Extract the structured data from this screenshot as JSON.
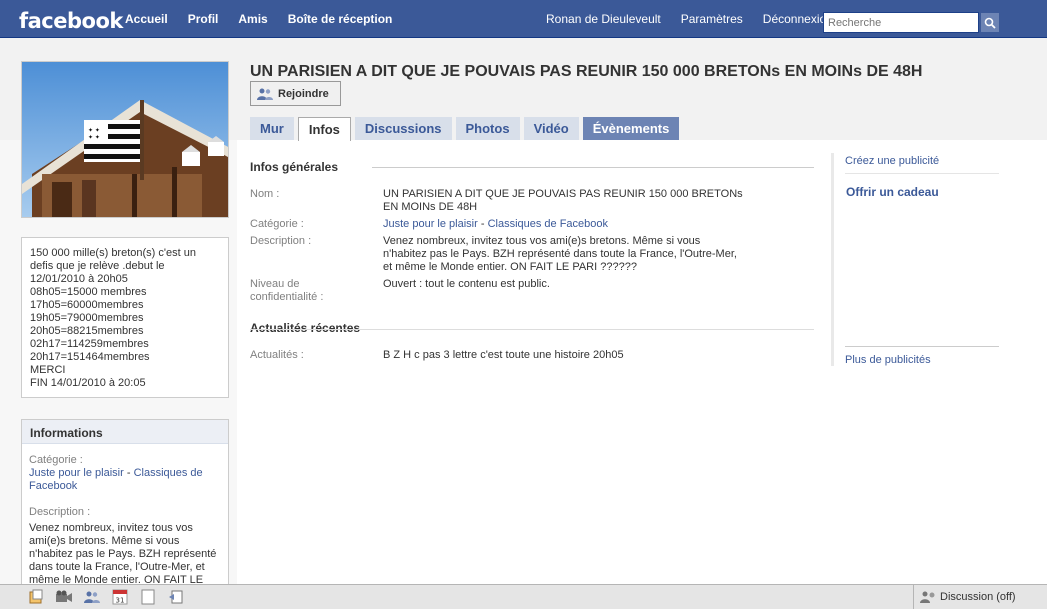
{
  "topbar": {
    "logo": "facebook",
    "nav_left": [
      "Accueil",
      "Profil",
      "Amis",
      "Boîte de réception"
    ],
    "nav_right": [
      "Ronan de Dieuleveult",
      "Paramètres",
      "Déconnexion"
    ],
    "search_placeholder": "Recherche"
  },
  "group": {
    "title": "UN PARISIEN A DIT QUE JE POUVAIS PAS REUNIR 150 000 BRETONs EN MOINs DE 48H",
    "join_label": "Rejoindre"
  },
  "tabs": [
    {
      "label": "Mur",
      "state": "normal"
    },
    {
      "label": "Infos",
      "state": "active"
    },
    {
      "label": "Discussions",
      "state": "normal"
    },
    {
      "label": "Photos",
      "state": "normal"
    },
    {
      "label": "Vidéo",
      "state": "normal"
    },
    {
      "label": "Évènements",
      "state": "dark"
    }
  ],
  "left": {
    "description_lines": [
      "150 000 mille(s) breton(s) c'est un",
      "defis que je relève .debut le",
      "12/01/2010 à 20h05",
      "08h05=15000 membres",
      "17h05=60000membres",
      "19h05=79000membres",
      "20h05=88215membres",
      "02h17=114259membres",
      "20h17=151464membres",
      "MERCI",
      "FIN 14/01/2010 à 20:05"
    ],
    "info_box": {
      "title": "Informations",
      "category_label": "Catégorie :",
      "category_link1": "Juste pour le plaisir",
      "category_sep": " - ",
      "category_link2": "Classiques de Facebook",
      "description_label": "Description :",
      "description_text": "Venez nombreux, invitez tous vos ami(e)s bretons. Même si vous n'habitez pas le Pays. BZH représenté dans toute la France, l'Outre-Mer, et même le Monde entier. ON FAIT LE"
    }
  },
  "infos": {
    "general_heading": "Infos générales",
    "nom_label": "Nom :",
    "nom_value": "UN PARISIEN A DIT QUE JE POUVAIS PAS REUNIR 150 000 BRETONs EN MOINs DE 48H",
    "category_label": "Catégorie :",
    "category_link1": "Juste pour le plaisir",
    "category_sep": " - ",
    "category_link2": "Classiques de Facebook",
    "description_label": "Description :",
    "description_value": "Venez nombreux, invitez tous vos ami(e)s bretons. Même si vous n'habitez pas le Pays. BZH représenté dans toute la France, l'Outre-Mer, et même le Monde entier. ON FAIT LE PARI ??????",
    "privacy_label": "Niveau de confidentialité :",
    "privacy_value": "Ouvert : tout le contenu est public.",
    "news_heading": "Actualités récentes",
    "news_label": "Actualités :",
    "news_value": "B Z H c pas 3 lettre c'est toute une histoire 20h05"
  },
  "ads": {
    "create": "Créez une publicité",
    "gift": "Offrir un cadeau",
    "more": "Plus de publicités"
  },
  "chatbar": {
    "chat_label": "Discussion (off)",
    "calendar_day": "31"
  },
  "colors": {
    "brand_blue": "#3b5998",
    "tab_light": "#d8dfea",
    "tab_dark": "#6d84b4"
  }
}
